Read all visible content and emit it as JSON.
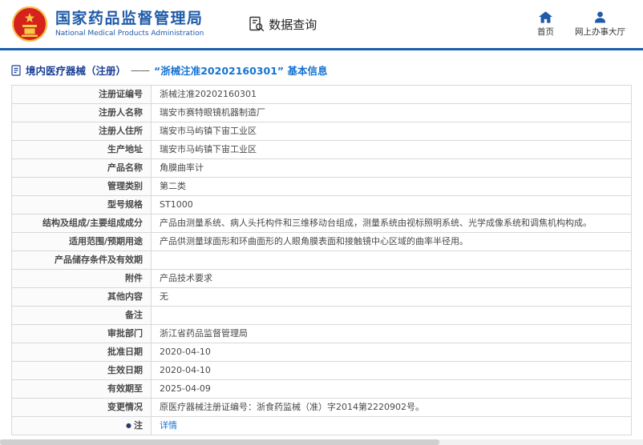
{
  "header": {
    "org_name_cn": "国家药品监督管理局",
    "org_name_en": "National Medical Products Administration",
    "nav_data_query": "数据查询",
    "nav_home": "首页",
    "nav_hall": "网上办事大厅"
  },
  "breadcrumb": {
    "category": "境内医疗器械（注册）",
    "separator": "——",
    "title": "“浙械注准20202160301” 基本信息"
  },
  "colors": {
    "brand_blue": "#1f5ba8",
    "divider_blue": "#1c5eae",
    "link_blue": "#1673d2",
    "emblem_red": "#d6221c",
    "emblem_gold": "#f7c948"
  },
  "table": {
    "rows": [
      {
        "label": "注册证编号",
        "value": "浙械注准20202160301"
      },
      {
        "label": "注册人名称",
        "value": "瑞安市赛特眼镜机器制造厂"
      },
      {
        "label": "注册人住所",
        "value": "瑞安市马屿镇下宙工业区"
      },
      {
        "label": "生产地址",
        "value": "瑞安市马屿镇下宙工业区"
      },
      {
        "label": "产品名称",
        "value": "角膜曲率计"
      },
      {
        "label": "管理类别",
        "value": "第二类"
      },
      {
        "label": "型号规格",
        "value": "ST1000"
      },
      {
        "label": "结构及组成/主要组成成分",
        "value": "产品由测量系统、病人头托构件和三维移动台组成，测量系统由视标照明系统、光学成像系统和调焦机构构成。"
      },
      {
        "label": "适用范围/预期用途",
        "value": "产品供测量球面形和环曲面形的人眼角膜表面和接触镜中心区域的曲率半径用。"
      },
      {
        "label": "产品储存条件及有效期",
        "value": ""
      },
      {
        "label": "附件",
        "value": "产品技术要求"
      },
      {
        "label": "其他内容",
        "value": "无"
      },
      {
        "label": "备注",
        "value": ""
      },
      {
        "label": "审批部门",
        "value": "浙江省药品监督管理局"
      },
      {
        "label": "批准日期",
        "value": "2020-04-10"
      },
      {
        "label": "生效日期",
        "value": "2020-04-10"
      },
      {
        "label": "有效期至",
        "value": "2025-04-09"
      },
      {
        "label": "变更情况",
        "value": "原医疗器械注册证编号：浙食药监械（准）字2014第2220902号。"
      },
      {
        "label": "注",
        "bullet": "●",
        "value": "详情",
        "link": true
      }
    ]
  }
}
